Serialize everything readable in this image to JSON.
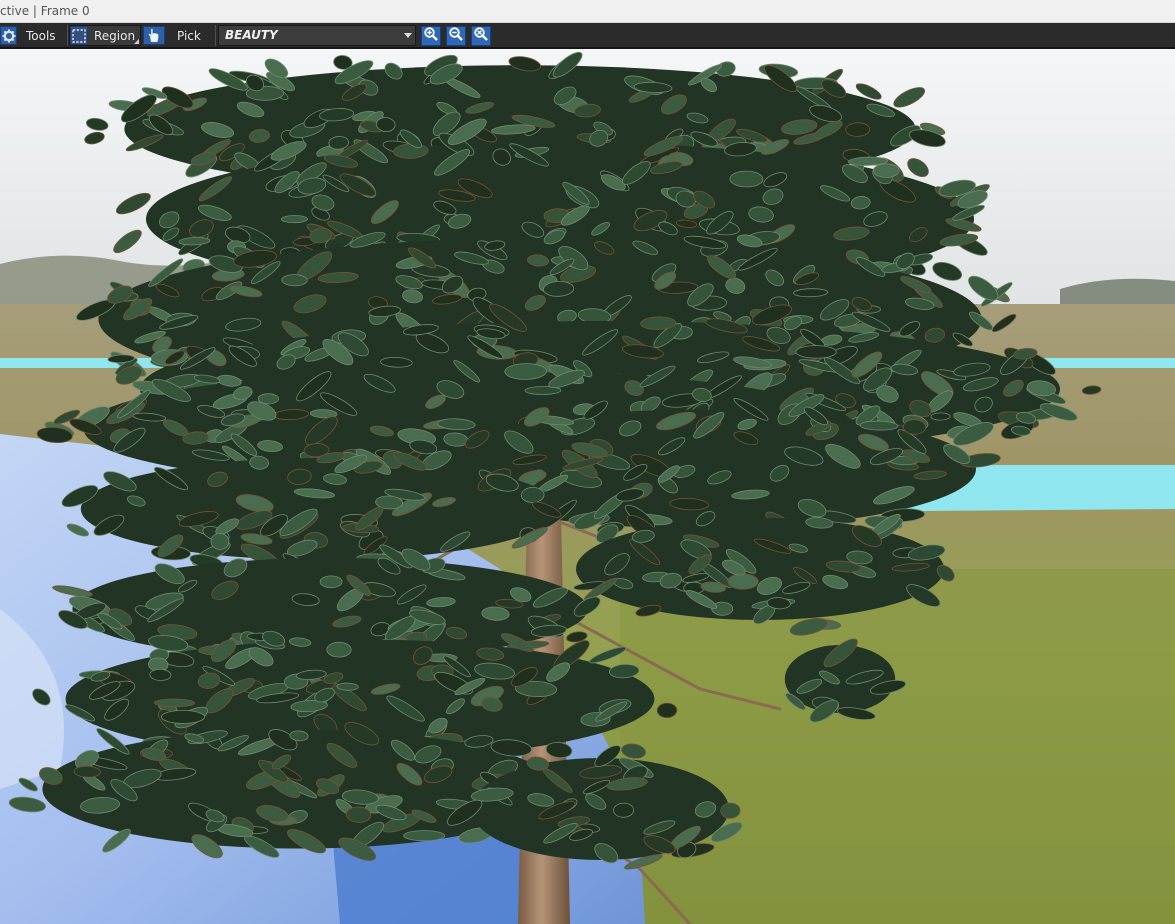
{
  "window": {
    "title": "ctive | Frame 0"
  },
  "toolbar": {
    "tools_label": "Tools",
    "region_label": "Region",
    "pick_label": "Pick",
    "render_pass": {
      "selected": "BEAUTY"
    },
    "icons": {
      "tools": "gear-icon",
      "region": "region-select-icon",
      "pick": "hand-pointer-icon",
      "zoom_in": "zoom-in-icon",
      "zoom_out": "zoom-out-icon",
      "zoom_reset": "zoom-reset-icon"
    }
  },
  "viewport": {
    "content": "rendered-pine-tree"
  },
  "colors": {
    "toolbar_bg": "#2b2b2b",
    "accent_blue": "#2f68b8",
    "sky": "#e8ecef",
    "field": "#9b9366",
    "grass": "#8a9845",
    "cyan_plane": "#8fe6ee",
    "cloth": "#a7c1ee",
    "needles_dark": "#263b28",
    "needles_mid": "#3f5f44",
    "trunk": "#9e7d61"
  }
}
